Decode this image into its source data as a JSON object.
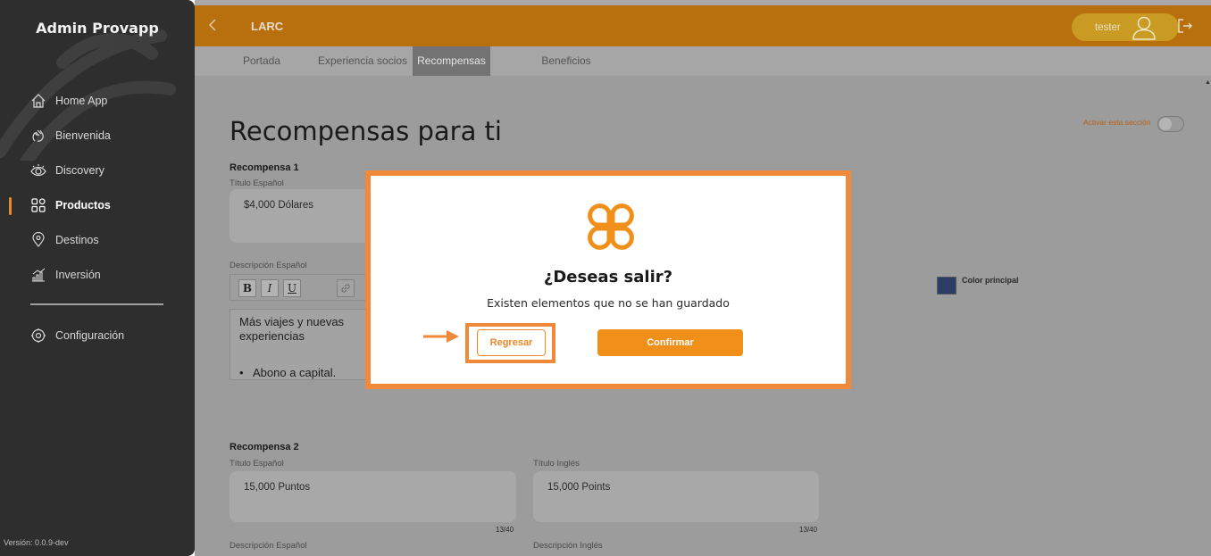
{
  "sidebar": {
    "brand": "Admin Provapp",
    "items": [
      {
        "label": "Home App",
        "icon": "home-icon"
      },
      {
        "label": "Bienvenida",
        "icon": "wave-hand-icon"
      },
      {
        "label": "Discovery",
        "icon": "eye-icon"
      },
      {
        "label": "Productos",
        "icon": "grid-icon",
        "active": true
      },
      {
        "label": "Destinos",
        "icon": "location-pin-icon"
      },
      {
        "label": "Inversión",
        "icon": "bar-chart-icon"
      }
    ],
    "settings": {
      "label": "Configuración",
      "icon": "gear-icon"
    },
    "version": "Versión: 0.0.9-dev"
  },
  "header": {
    "title": "LARC",
    "user": "tester"
  },
  "tabs": [
    {
      "label": "Portada"
    },
    {
      "label": "Experiencia socios"
    },
    {
      "label": "Recompensas",
      "active": true
    },
    {
      "label": "Beneficios"
    }
  ],
  "main": {
    "title": "Recompensas para ti",
    "toggle_label": "Activar esta sección",
    "color_label": "Color principal",
    "reward1": {
      "heading": "Recompensa 1",
      "title_es_label": "Título Español",
      "title_es_value": "$4,000 Dólares",
      "desc_es_label": "Descripción Español",
      "desc_text": "Más viajes y nuevas experiencias",
      "desc_bullet": "Abono a capital.",
      "toolbar": {
        "bold": "B",
        "italic": "I",
        "underline": "U"
      }
    },
    "reward2": {
      "heading": "Recompensa 2",
      "title_es_label": "Título Español",
      "title_es_value": "15,000 Puntos",
      "title_es_count": "13/40",
      "title_en_label": "Título Inglés",
      "title_en_value": "15,000 Points",
      "title_en_count": "13/40",
      "desc_es_label": "Descripción Español",
      "desc_en_label": "Descripción Inglés"
    }
  },
  "modal": {
    "title": "¿Deseas salir?",
    "subtitle": "Existen elementos que no se han guardado",
    "back_label": "Regresar",
    "confirm_label": "Confirmar"
  },
  "colors": {
    "accent": "#f0901a",
    "header": "#b8700f",
    "sidebar": "#2e2e2e",
    "swatch": "#2b3d66"
  }
}
